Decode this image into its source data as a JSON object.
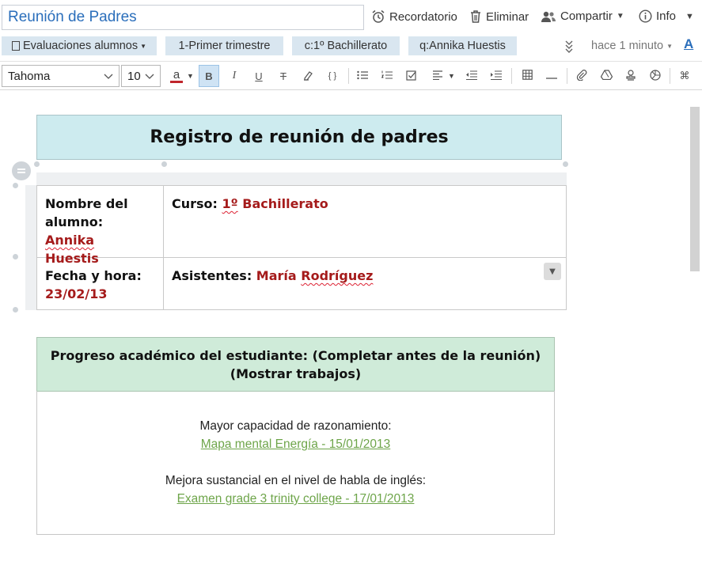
{
  "title_value": "Reunión de Padres",
  "actions": {
    "reminder": "Recordatorio",
    "delete": "Eliminar",
    "share": "Compartir",
    "info": "Info"
  },
  "tags": {
    "notebook": "Evaluaciones alumnos",
    "t1": "1-Primer trimestre",
    "t2": "c:1º Bachillerato",
    "t3": "q:Annika Huestis",
    "modified": "hace 1 minuto"
  },
  "toolbar": {
    "font": "Tahoma",
    "size": "10",
    "text_color": "#c0262d",
    "bold": "B",
    "italic": "I",
    "underline": "U",
    "strike": "T",
    "code": "{ }",
    "font_color_glyph": "a",
    "shortcut_glyph": "⌘"
  },
  "doc": {
    "title": "Registro de reunión de padres",
    "student_label_1": "Nombre del",
    "student_label_2": "alumno: ",
    "student_first": "Annika",
    "student_last": "Huestis",
    "course_label": "Curso: ",
    "course_num": "1º",
    "course_name": " Bachillerato",
    "date_label": "Fecha y hora:",
    "date_value": "23/02/13",
    "attendees_label": "Asistentes: ",
    "attendee_first": "María ",
    "attendee_last": "Rodríguez",
    "progress_title_1": "Progreso académico del estudiante: (Completar antes de la reunión)",
    "progress_title_2": "(Mostrar trabajos)",
    "item1_text": "Mayor capacidad de razonamiento:",
    "item1_link": "Mapa mental Energía - 15/01/2013",
    "item2_text": "Mejora sustancial en el nivel de habla de inglés:",
    "item2_link": "Examen grade 3 trinity college - 17/01/2013"
  },
  "colors": {
    "accent_blue": "#2a6ebb",
    "header1_bg": "#cdebef",
    "header2_bg": "#cfebd9",
    "value_red": "#a51b1b",
    "link_green": "#6ea54a"
  }
}
